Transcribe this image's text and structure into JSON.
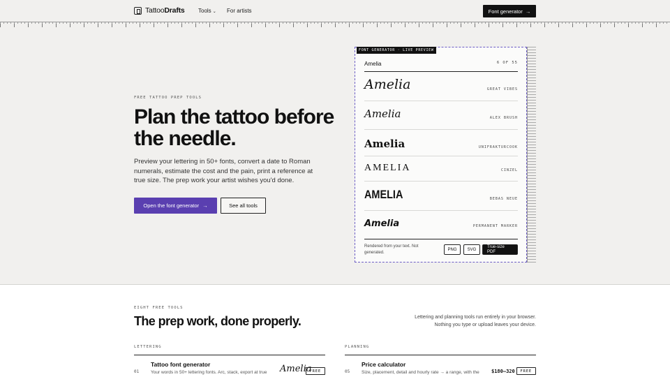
{
  "nav": {
    "logo_prefix": "Tattoo",
    "logo_suffix": "Drafts",
    "tools_label": "Tools",
    "artists_label": "For artists",
    "cta_label": "Font generator",
    "cta_arrow": "→"
  },
  "hero": {
    "eyebrow": "FREE TATTOO PREP TOOLS",
    "title": "Plan the tattoo before the needle.",
    "subtitle": "Preview your lettering in 50+ fonts, convert a date to Roman numerals, estimate the cost and the pain, print a reference at true size. The prep work your artist wishes you'd done.",
    "primary_button": "Open the font generator",
    "primary_arrow": "→",
    "secondary_button": "See all tools"
  },
  "preview": {
    "tag": "FONT GENERATOR · LIVE PREVIEW",
    "input_text": "Amelia",
    "count": "6 OF 55",
    "rows": [
      {
        "sample": "Amelia",
        "font": "GREAT VIBES"
      },
      {
        "sample": "Amelia",
        "font": "ALEX BRUSH"
      },
      {
        "sample": "Amelia",
        "font": "UNIFRAKTURCOOK"
      },
      {
        "sample": "AMELIA",
        "font": "CINZEL"
      },
      {
        "sample": "AMELIA",
        "font": "BEBAS NEUE"
      },
      {
        "sample": "Amelia",
        "font": "PERMANENT MARKER"
      }
    ],
    "footnote": "Rendered from your text. Not generated.",
    "png_label": "PNG",
    "svg_label": "SVG",
    "pdf_label": "True-size PDF"
  },
  "tools_section": {
    "eyebrow": "EIGHT FREE TOOLS",
    "title": "The prep work, done properly.",
    "side_text_1": "Lettering and planning tools run entirely in your browser.",
    "side_text_2": "Nothing you type or upload leaves your device.",
    "lettering_head": "LETTERING",
    "planning_head": "PLANNING",
    "lettering_tools": [
      {
        "num": "01",
        "name": "Tattoo font generator",
        "desc": "Your words in 50+ lettering fonts. Arc, stack, export at true",
        "preview": "Amelia",
        "badge": "FREE"
      }
    ],
    "planning_tools": [
      {
        "num": "05",
        "name": "Price calculator",
        "desc": "Size, placement, detail and hourly rate → a range, with the",
        "price": "$180–320",
        "badge": "FREE"
      }
    ]
  }
}
